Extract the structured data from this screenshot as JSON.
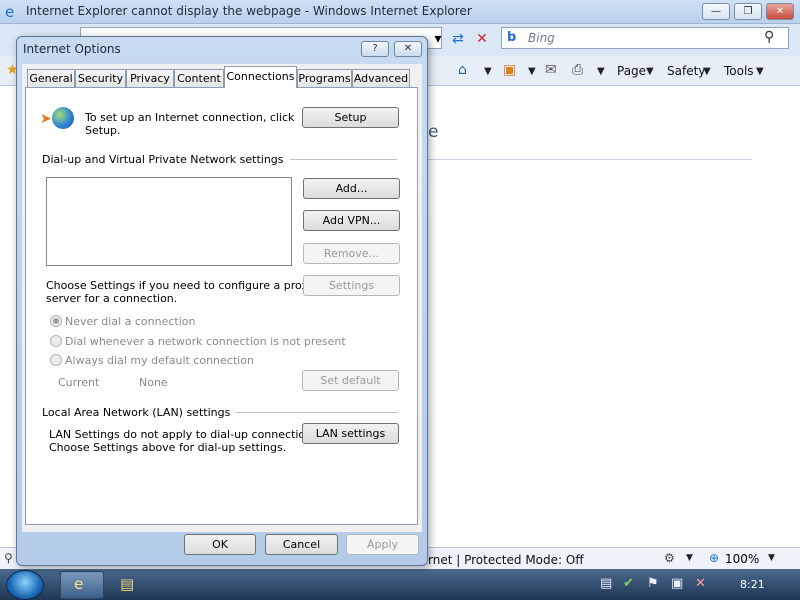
{
  "browser": {
    "title": "Internet Explorer cannot display the webpage - Windows Internet Explorer",
    "search_placeholder": "Bing",
    "bing_logo": "b",
    "commands": [
      "Page",
      "Safety",
      "Tools"
    ],
    "page_fragment": "e",
    "status": "rnet | Protected Mode: Off",
    "zoom": "100%"
  },
  "taskbar": {
    "clock": "8:21"
  },
  "dialog": {
    "title": "Internet Options",
    "help_label": "?",
    "close_label": "✕",
    "tabs": [
      "General",
      "Security",
      "Privacy",
      "Content",
      "Connections",
      "Programs",
      "Advanced"
    ],
    "active_tab": "Connections",
    "setup": {
      "text_line1": "To set up an Internet connection, click",
      "text_line2": "Setup.",
      "button": "Setup"
    },
    "dialup": {
      "section_label": "Dial-up and Virtual Private Network settings",
      "add_button": "Add...",
      "add_vpn_button": "Add VPN...",
      "remove_button": "Remove...",
      "proxy_text_line1": "Choose Settings if you need to configure a proxy",
      "proxy_text_line2": "server for a connection.",
      "settings_button": "Settings",
      "radios": [
        {
          "label": "Never dial a connection",
          "checked": true
        },
        {
          "label": "Dial whenever a network connection is not present",
          "checked": false
        },
        {
          "label": "Always dial my default connection",
          "checked": false
        }
      ],
      "current_label": "Current",
      "current_value": "None",
      "set_default_button": "Set default"
    },
    "lan": {
      "section_label": "Local Area Network (LAN) settings",
      "text_line1": "LAN Settings do not apply to dial-up connections.",
      "text_line2": "Choose Settings above for dial-up settings.",
      "button": "LAN settings"
    },
    "footer": {
      "ok": "OK",
      "cancel": "Cancel",
      "apply": "Apply"
    }
  }
}
